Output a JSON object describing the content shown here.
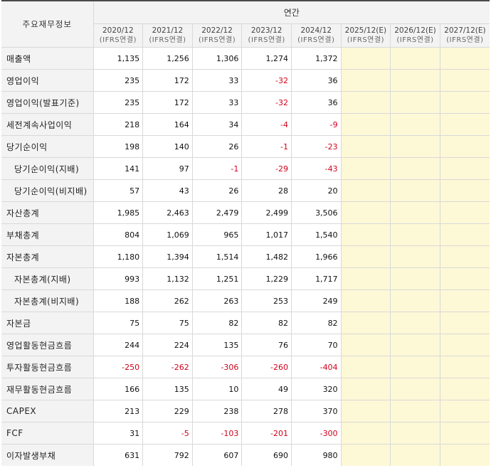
{
  "header": {
    "corner_label": "주요재무정보",
    "group_label": "연간",
    "periods": [
      {
        "year": "2020/12",
        "basis": "(IFRS연결)"
      },
      {
        "year": "2021/12",
        "basis": "(IFRS연결)"
      },
      {
        "year": "2022/12",
        "basis": "(IFRS연결)"
      },
      {
        "year": "2023/12",
        "basis": "(IFRS연결)"
      },
      {
        "year": "2024/12",
        "basis": "(IFRS연결)"
      },
      {
        "year": "2025/12(E)",
        "basis": "(IFRS연결)"
      },
      {
        "year": "2026/12(E)",
        "basis": "(IFRS연결)"
      },
      {
        "year": "2027/12(E)",
        "basis": "(IFRS연결)"
      }
    ]
  },
  "colors": {
    "negative": "#d0021b",
    "estimate_fill": "#fdf8d6",
    "header_fill": "#f3f3f3"
  },
  "rows": [
    {
      "label": "매출액",
      "indent": false,
      "values": [
        "1,135",
        "1,256",
        "1,306",
        "1,274",
        "1,372",
        "",
        "",
        ""
      ]
    },
    {
      "label": "영업이익",
      "indent": false,
      "values": [
        "235",
        "172",
        "33",
        "-32",
        "36",
        "",
        "",
        ""
      ]
    },
    {
      "label": "영업이익(발표기준)",
      "indent": false,
      "values": [
        "235",
        "172",
        "33",
        "-32",
        "36",
        "",
        "",
        ""
      ]
    },
    {
      "label": "세전계속사업이익",
      "indent": false,
      "values": [
        "218",
        "164",
        "34",
        "-4",
        "-9",
        "",
        "",
        ""
      ]
    },
    {
      "label": "당기순이익",
      "indent": false,
      "values": [
        "198",
        "140",
        "26",
        "-1",
        "-23",
        "",
        "",
        ""
      ]
    },
    {
      "label": "당기순이익(지배)",
      "indent": true,
      "values": [
        "141",
        "97",
        "-1",
        "-29",
        "-43",
        "",
        "",
        ""
      ]
    },
    {
      "label": "당기순이익(비지배)",
      "indent": true,
      "values": [
        "57",
        "43",
        "26",
        "28",
        "20",
        "",
        "",
        ""
      ]
    },
    {
      "label": "자산총계",
      "indent": false,
      "values": [
        "1,985",
        "2,463",
        "2,479",
        "2,499",
        "3,506",
        "",
        "",
        ""
      ]
    },
    {
      "label": "부채총계",
      "indent": false,
      "values": [
        "804",
        "1,069",
        "965",
        "1,017",
        "1,540",
        "",
        "",
        ""
      ]
    },
    {
      "label": "자본총계",
      "indent": false,
      "values": [
        "1,180",
        "1,394",
        "1,514",
        "1,482",
        "1,966",
        "",
        "",
        ""
      ]
    },
    {
      "label": "자본총계(지배)",
      "indent": true,
      "values": [
        "993",
        "1,132",
        "1,251",
        "1,229",
        "1,717",
        "",
        "",
        ""
      ]
    },
    {
      "label": "자본총계(비지배)",
      "indent": true,
      "values": [
        "188",
        "262",
        "263",
        "253",
        "249",
        "",
        "",
        ""
      ]
    },
    {
      "label": "자본금",
      "indent": false,
      "values": [
        "75",
        "75",
        "82",
        "82",
        "82",
        "",
        "",
        ""
      ]
    },
    {
      "label": "영업활동현금흐름",
      "indent": false,
      "values": [
        "244",
        "224",
        "135",
        "76",
        "70",
        "",
        "",
        ""
      ]
    },
    {
      "label": "투자활동현금흐름",
      "indent": false,
      "values": [
        "-250",
        "-262",
        "-306",
        "-260",
        "-404",
        "",
        "",
        ""
      ]
    },
    {
      "label": "재무활동현금흐름",
      "indent": false,
      "values": [
        "166",
        "135",
        "10",
        "49",
        "320",
        "",
        "",
        ""
      ]
    },
    {
      "label": "CAPEX",
      "indent": false,
      "values": [
        "213",
        "229",
        "238",
        "278",
        "370",
        "",
        "",
        ""
      ]
    },
    {
      "label": "FCF",
      "indent": false,
      "values": [
        "31",
        "-5",
        "-103",
        "-201",
        "-300",
        "",
        "",
        ""
      ]
    },
    {
      "label": "이자발생부채",
      "indent": false,
      "values": [
        "631",
        "792",
        "607",
        "690",
        "980",
        "",
        "",
        ""
      ]
    }
  ]
}
